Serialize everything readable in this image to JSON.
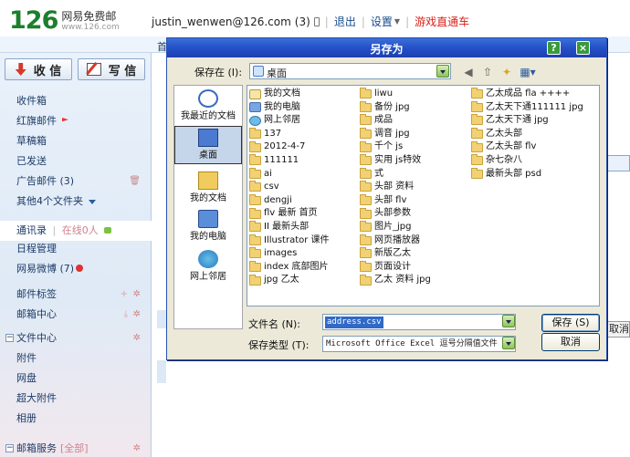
{
  "app": {
    "logo_num": "126",
    "logo_cn": "网易免费邮",
    "logo_url": "www.126.com"
  },
  "topbar": {
    "user": "justin_wenwen@126.com",
    "unread": "(3)",
    "logout": "退出",
    "settings": "设置",
    "game": "游戏直通车",
    "tab_stub": "首"
  },
  "sidebar": {
    "receive_label": "收 信",
    "write_label": "写 信",
    "items": [
      {
        "label": "收件箱"
      },
      {
        "label": "红旗邮件"
      },
      {
        "label": "草稿箱"
      },
      {
        "label": "已发送"
      },
      {
        "label": "广告邮件 (3)"
      },
      {
        "label": "其他4个文件夹"
      }
    ],
    "contacts": "通讯录",
    "online_sep": "|",
    "online": "在线0人",
    "apps": [
      {
        "label": "日程管理"
      },
      {
        "label": "网易微博 (7)"
      }
    ],
    "tags": "邮件标签",
    "center": "邮箱中心",
    "file_center": "文件中心",
    "file_items": [
      {
        "label": "附件"
      },
      {
        "label": "网盘"
      },
      {
        "label": "超大附件"
      },
      {
        "label": "相册"
      }
    ],
    "service": "邮箱服务",
    "service_all": "[全部]"
  },
  "background": {
    "cancel_peek": "取消"
  },
  "dialog": {
    "title": "另存为",
    "help_btn": "?",
    "close_btn": "×",
    "save_in_label": "保存在 (I):",
    "save_in_value": "桌面",
    "places": [
      {
        "label": "我最近的文档",
        "icon": "recent-documents-icon"
      },
      {
        "label": "桌面",
        "icon": "desktop-icon",
        "selected": true
      },
      {
        "label": "我的文档",
        "icon": "my-documents-icon"
      },
      {
        "label": "我的电脑",
        "icon": "my-computer-icon"
      },
      {
        "label": "网上邻居",
        "icon": "network-places-icon"
      }
    ],
    "files_col1": [
      {
        "label": "我的文档",
        "icon": "doc"
      },
      {
        "label": "我的电脑",
        "icon": "pc"
      },
      {
        "label": "网上邻居",
        "icon": "net"
      },
      {
        "label": "137",
        "icon": "folder"
      },
      {
        "label": "2012-4-7",
        "icon": "folder"
      },
      {
        "label": "111111",
        "icon": "folder"
      },
      {
        "label": "ai",
        "icon": "folder"
      },
      {
        "label": "csv",
        "icon": "folder"
      },
      {
        "label": "dengji",
        "icon": "folder"
      },
      {
        "label": "flv 最新 首页",
        "icon": "folder"
      },
      {
        "label": "II 最新头部",
        "icon": "folder"
      },
      {
        "label": "Illustrator 课件",
        "icon": "folder"
      },
      {
        "label": "images",
        "icon": "folder"
      },
      {
        "label": "index 底部图片",
        "icon": "folder"
      },
      {
        "label": "jpg 乙太",
        "icon": "folder"
      }
    ],
    "files_col2": [
      {
        "label": "liwu"
      },
      {
        "label": "备份 jpg"
      },
      {
        "label": "成品"
      },
      {
        "label": "调音 jpg"
      },
      {
        "label": "千个 js"
      },
      {
        "label": "实用 js特效"
      },
      {
        "label": "式"
      },
      {
        "label": "头部   资料"
      },
      {
        "label": "头部  flv"
      },
      {
        "label": "头部参数"
      },
      {
        "label": "图片_jpg"
      },
      {
        "label": "网页播放器"
      },
      {
        "label": "新版乙太"
      },
      {
        "label": "页面设计"
      },
      {
        "label": "乙太 资料 jpg"
      }
    ],
    "files_col3": [
      {
        "label": "乙太成品 fla ++++"
      },
      {
        "label": "乙太天下通111111 jpg"
      },
      {
        "label": "乙太天下通 jpg"
      },
      {
        "label": "乙太头部"
      },
      {
        "label": "乙太头部 flv"
      },
      {
        "label": "杂七杂八"
      },
      {
        "label": "最新头部 psd"
      }
    ],
    "filename_label": "文件名 (N):",
    "filename_value": "address.csv",
    "filetype_label": "保存类型 (T):",
    "filetype_value": "Microsoft Office Excel 逗号分隔值文件",
    "save_button": "保存 (S)",
    "cancel_button": "取消"
  }
}
